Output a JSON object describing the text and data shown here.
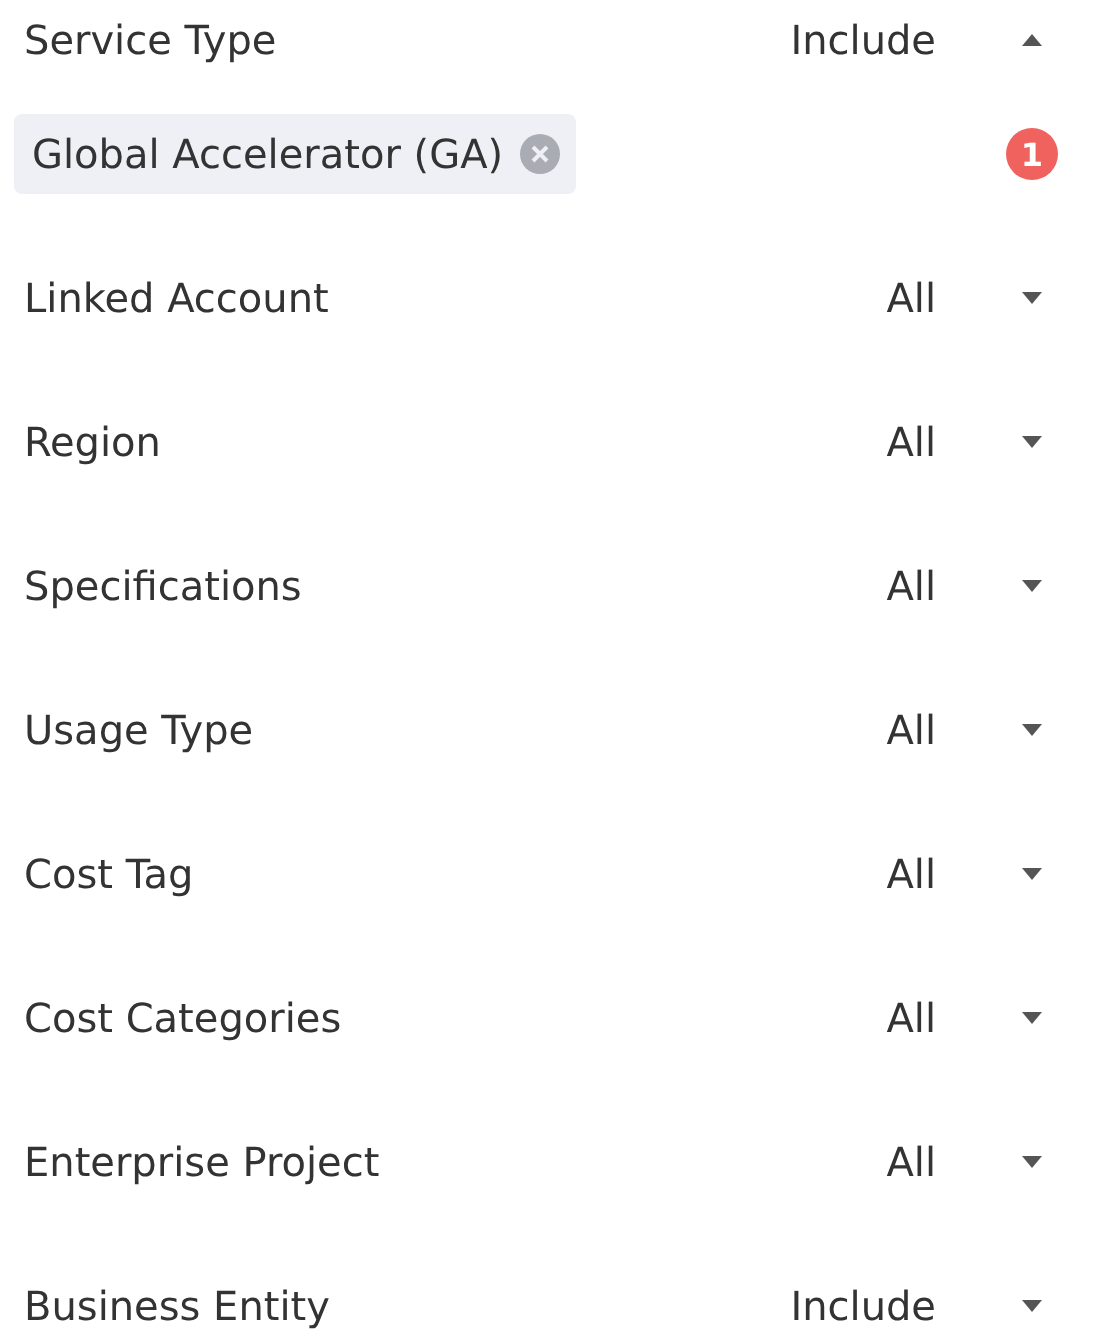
{
  "filters": [
    {
      "label": "Service Type",
      "value": "Include",
      "expanded": true,
      "tags": [
        {
          "label": "Global Accelerator (GA)"
        }
      ],
      "badge": "1"
    },
    {
      "label": "Linked Account",
      "value": "All",
      "expanded": false
    },
    {
      "label": "Region",
      "value": "All",
      "expanded": false
    },
    {
      "label": "Specifications",
      "value": "All",
      "expanded": false
    },
    {
      "label": "Usage Type",
      "value": "All",
      "expanded": false
    },
    {
      "label": "Cost Tag",
      "value": "All",
      "expanded": false
    },
    {
      "label": "Cost Categories",
      "value": "All",
      "expanded": false
    },
    {
      "label": "Enterprise Project",
      "value": "All",
      "expanded": false
    },
    {
      "label": "Business Entity",
      "value": "Include",
      "expanded": false
    }
  ]
}
